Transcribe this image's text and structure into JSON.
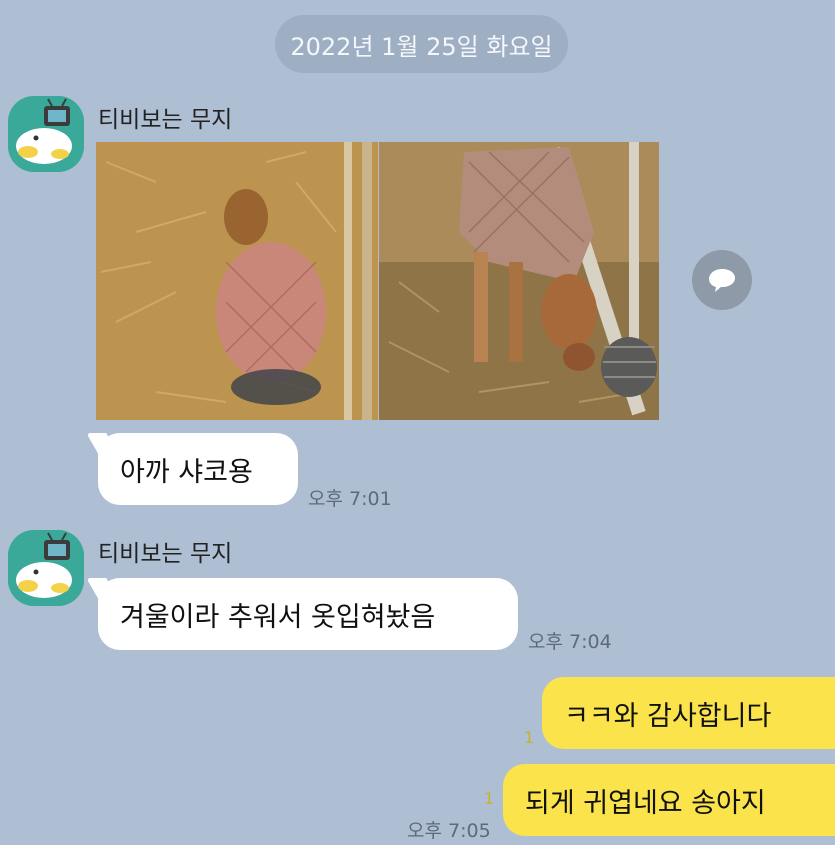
{
  "date_header": "2022년 1월 25일 화요일",
  "messages": [
    {
      "sender": "티비보는 무지",
      "photos": [
        "calf-lying-photo",
        "calf-eating-photo"
      ],
      "text": "아까 샤코용",
      "time": "오후 7:01"
    },
    {
      "sender": "티비보는 무지",
      "text": "겨울이라 추워서 옷입혀놨음",
      "time": "오후 7:04"
    },
    {
      "text": "ㅋㅋ와 감사합니다",
      "unread": "1"
    },
    {
      "text": "되게 귀엽네요 송아지",
      "unread": "1",
      "time": "오후 7:05"
    }
  ],
  "icons": {
    "avatar": "muzi-tv-avatar-icon",
    "share": "chat-bubble-icon"
  },
  "colors": {
    "background": "#aebfd4",
    "incoming_bubble": "#ffffff",
    "outgoing_bubble": "#fbe44b",
    "avatar_bg": "#3aa99a"
  }
}
